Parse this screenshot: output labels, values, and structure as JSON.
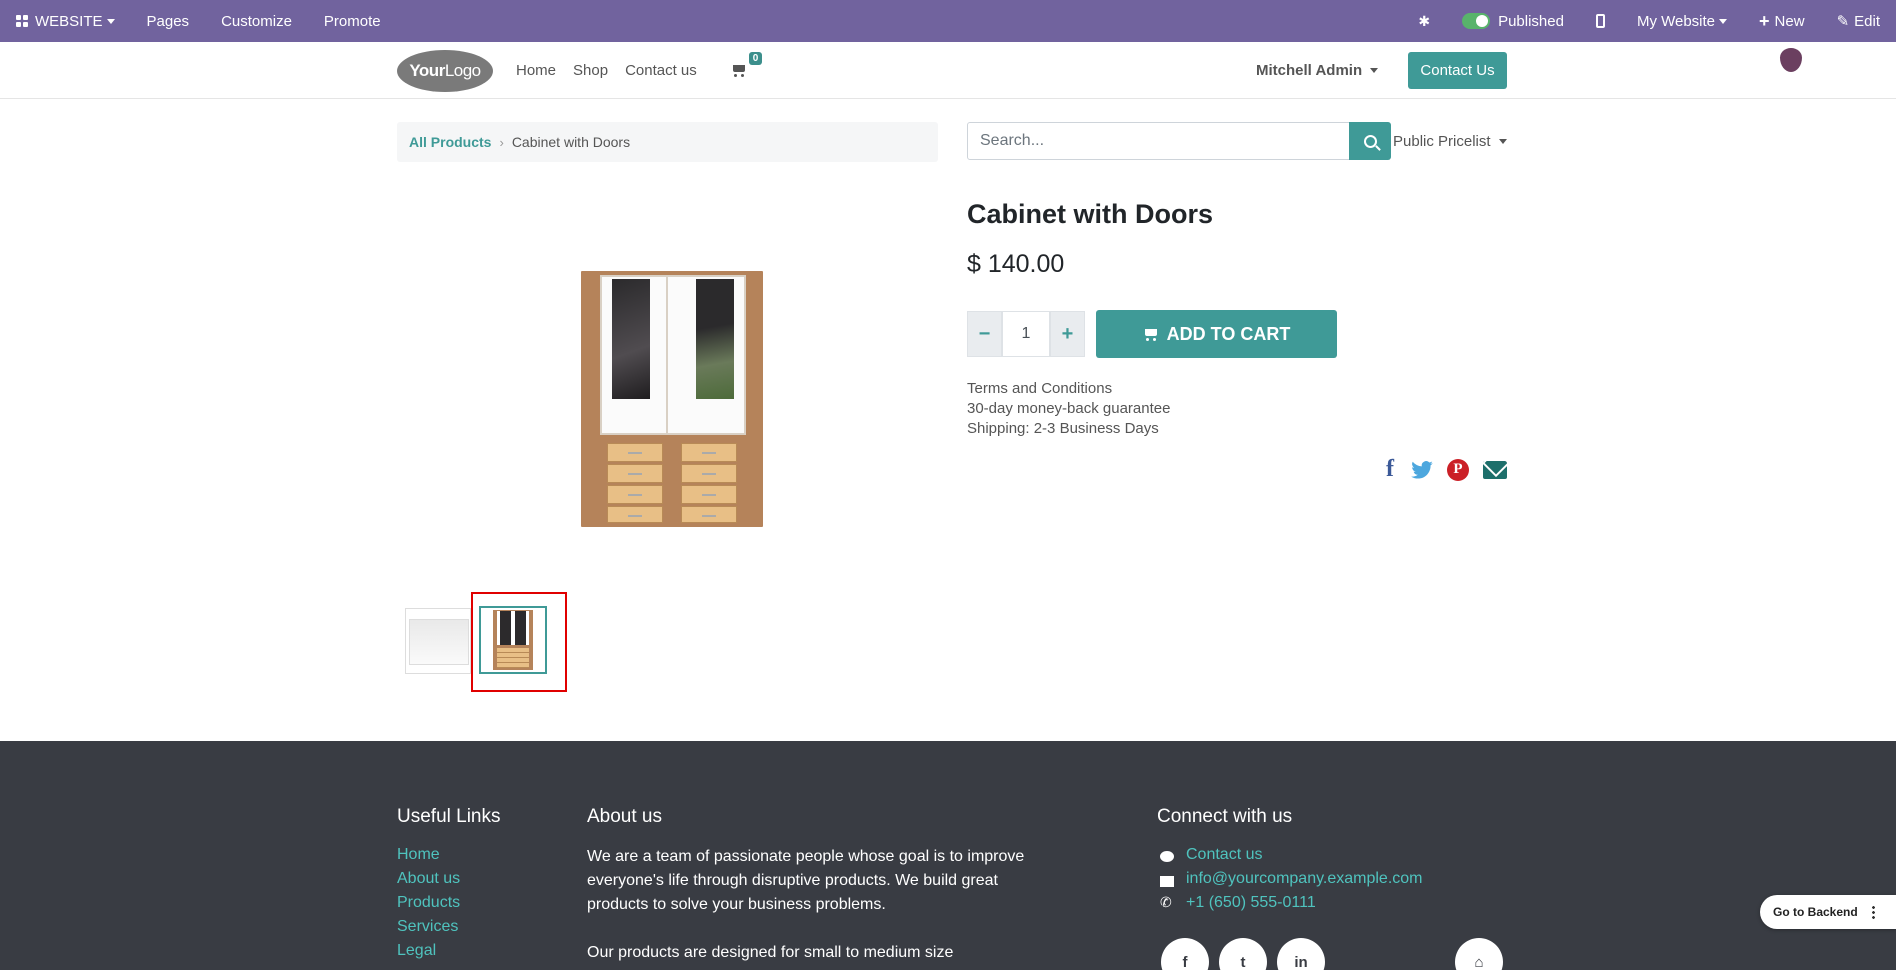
{
  "admin_bar": {
    "website_label": "WEBSITE",
    "pages_label": "Pages",
    "customize_label": "Customize",
    "promote_label": "Promote",
    "published_label": "Published",
    "my_website_label": "My Website",
    "new_label": "New",
    "edit_label": "Edit",
    "bug_glyph": "✱",
    "plus_glyph": "+",
    "pencil_glyph": "✎"
  },
  "header": {
    "logo_bold": "Your",
    "logo_light": "Logo",
    "nav": [
      "Home",
      "Shop",
      "Contact us"
    ],
    "cart_count": "0",
    "user_name": "Mitchell Admin",
    "contact_button": "Contact Us"
  },
  "breadcrumb": {
    "all_products": "All Products",
    "separator": "›",
    "current": "Cabinet with Doors"
  },
  "search": {
    "placeholder": "Search...",
    "pricelist": "Public Pricelist"
  },
  "product": {
    "name": "Cabinet with Doors",
    "price": "$ 140.00",
    "quantity": "1",
    "minus_glyph": "−",
    "plus_glyph": "+",
    "add_to_cart": "ADD TO CART",
    "terms": [
      "Terms and Conditions",
      "30-day money-back guarantee",
      "Shipping: 2-3 Business Days"
    ],
    "share": {
      "facebook": "f",
      "pinterest": "P"
    }
  },
  "footer": {
    "useful_links_title": "Useful Links",
    "useful_links": [
      "Home",
      "About us",
      "Products",
      "Services",
      "Legal"
    ],
    "about_title": "About us",
    "about_text_1": "We are a team of passionate people whose goal is to improve everyone's life through disruptive products. We build great products to solve your business problems.",
    "about_text_2": "Our products are designed for small to medium size",
    "connect_title": "Connect with us",
    "contact_link": "Contact us",
    "email": "info@yourcompany.example.com",
    "phone": "+1 (650) 555-0111",
    "phone_glyph": "✆",
    "social": [
      "f",
      "t",
      "in",
      "⌂"
    ]
  },
  "backend_button": "Go to Backend",
  "colors": {
    "admin_bar": "#71639e",
    "primary": "#3f9a97",
    "footer_bg": "#393c43",
    "link_footer": "#4fc3be",
    "highlight_box": "#e00000"
  },
  "icons": [
    "apps-grid-icon",
    "bug-icon",
    "toggle-icon",
    "mobile-icon",
    "plus-icon",
    "pencil-icon",
    "cart-icon",
    "search-icon",
    "facebook-icon",
    "twitter-icon",
    "pinterest-icon",
    "envelope-icon",
    "comment-icon",
    "phone-icon",
    "home-icon",
    "linkedin-icon",
    "kebab-icon"
  ]
}
